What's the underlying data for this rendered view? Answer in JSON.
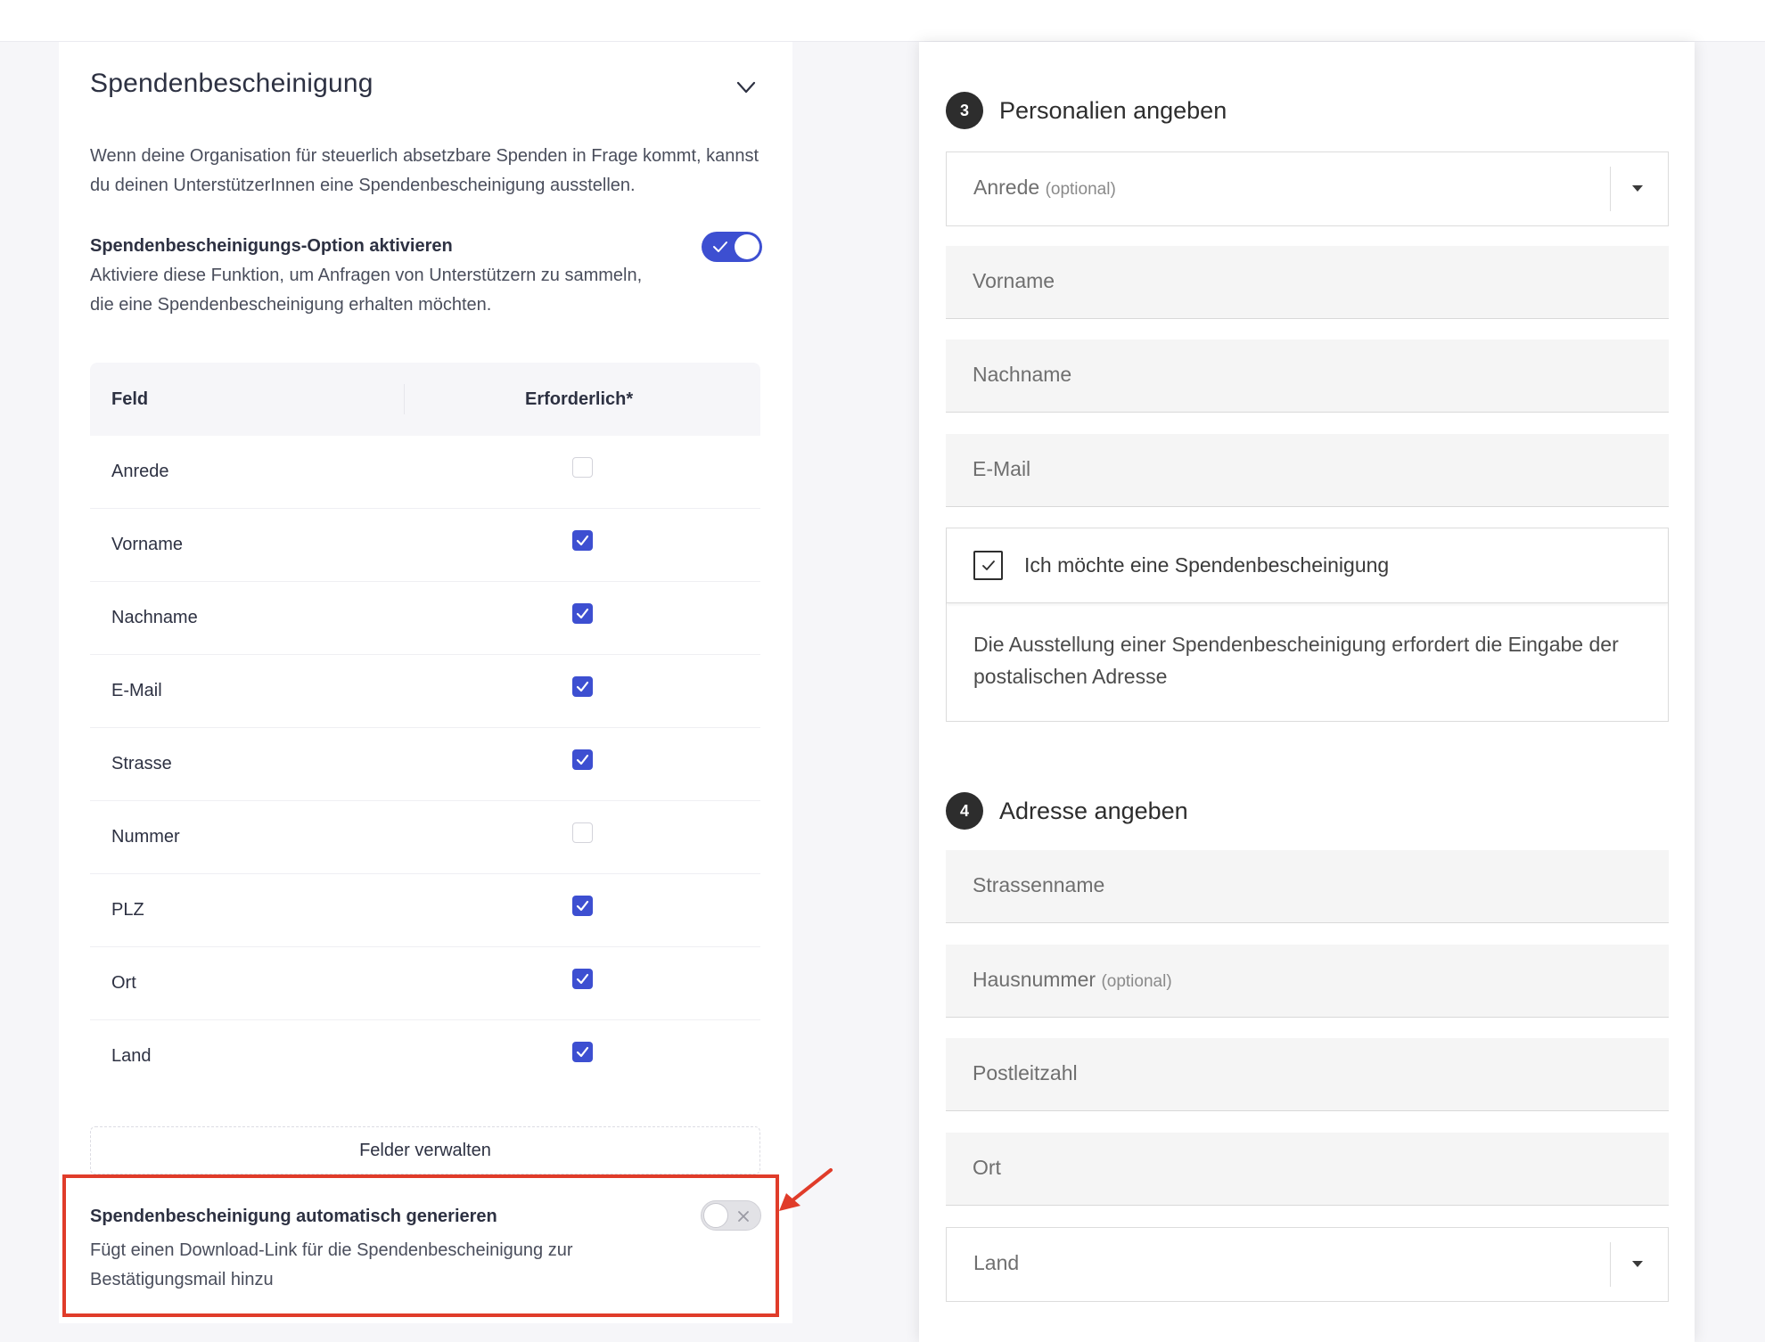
{
  "left": {
    "title": "Spendenbescheinigung",
    "description": "Wenn deine Organisation für steuerlich absetzbare Spenden in Frage kommt, kannst du deinen UnterstützerInnen eine Spendenbescheinigung ausstellen.",
    "option": {
      "title": "Spendenbescheinigungs-Option aktivieren",
      "description": "Aktiviere diese Funktion, um Anfragen von Unterstützern zu sammeln, die eine Spendenbescheinigung erhalten möchten.",
      "enabled": true
    },
    "table": {
      "headers": {
        "field": "Feld",
        "required": "Erforderlich*"
      },
      "rows": [
        {
          "label": "Anrede",
          "required": false
        },
        {
          "label": "Vorname",
          "required": true
        },
        {
          "label": "Nachname",
          "required": true
        },
        {
          "label": "E-Mail",
          "required": true
        },
        {
          "label": "Strasse",
          "required": true
        },
        {
          "label": "Nummer",
          "required": false
        },
        {
          "label": "PLZ",
          "required": true
        },
        {
          "label": "Ort",
          "required": true
        },
        {
          "label": "Land",
          "required": true
        }
      ]
    },
    "manage_button": "Felder verwalten",
    "auto_generate": {
      "title": "Spendenbescheinigung automatisch generieren",
      "description": "Fügt einen Download-Link für die Spendenbescheinigung zur Bestätigungsmail hinzu",
      "enabled": false
    }
  },
  "colors": {
    "accent": "#3d4fd1",
    "highlight": "#e03c2a"
  },
  "right": {
    "step3": {
      "number": "3",
      "label": "Personalien angeben"
    },
    "salutation": {
      "placeholder": "Anrede",
      "optional": "(optional)"
    },
    "first_name": "Vorname",
    "last_name": "Nachname",
    "email": "E-Mail",
    "consent": {
      "label": "Ich möchte eine Spendenbescheinigung",
      "checked": true,
      "note": "Die Ausstellung einer Spendenbescheinigung erfordert die Eingabe der postalischen Adresse"
    },
    "step4": {
      "number": "4",
      "label": "Adresse angeben"
    },
    "street": "Strassenname",
    "house_number": {
      "placeholder": "Hausnummer",
      "optional": "(optional)"
    },
    "postal_code": "Postleitzahl",
    "city": "Ort",
    "country": "Land"
  }
}
